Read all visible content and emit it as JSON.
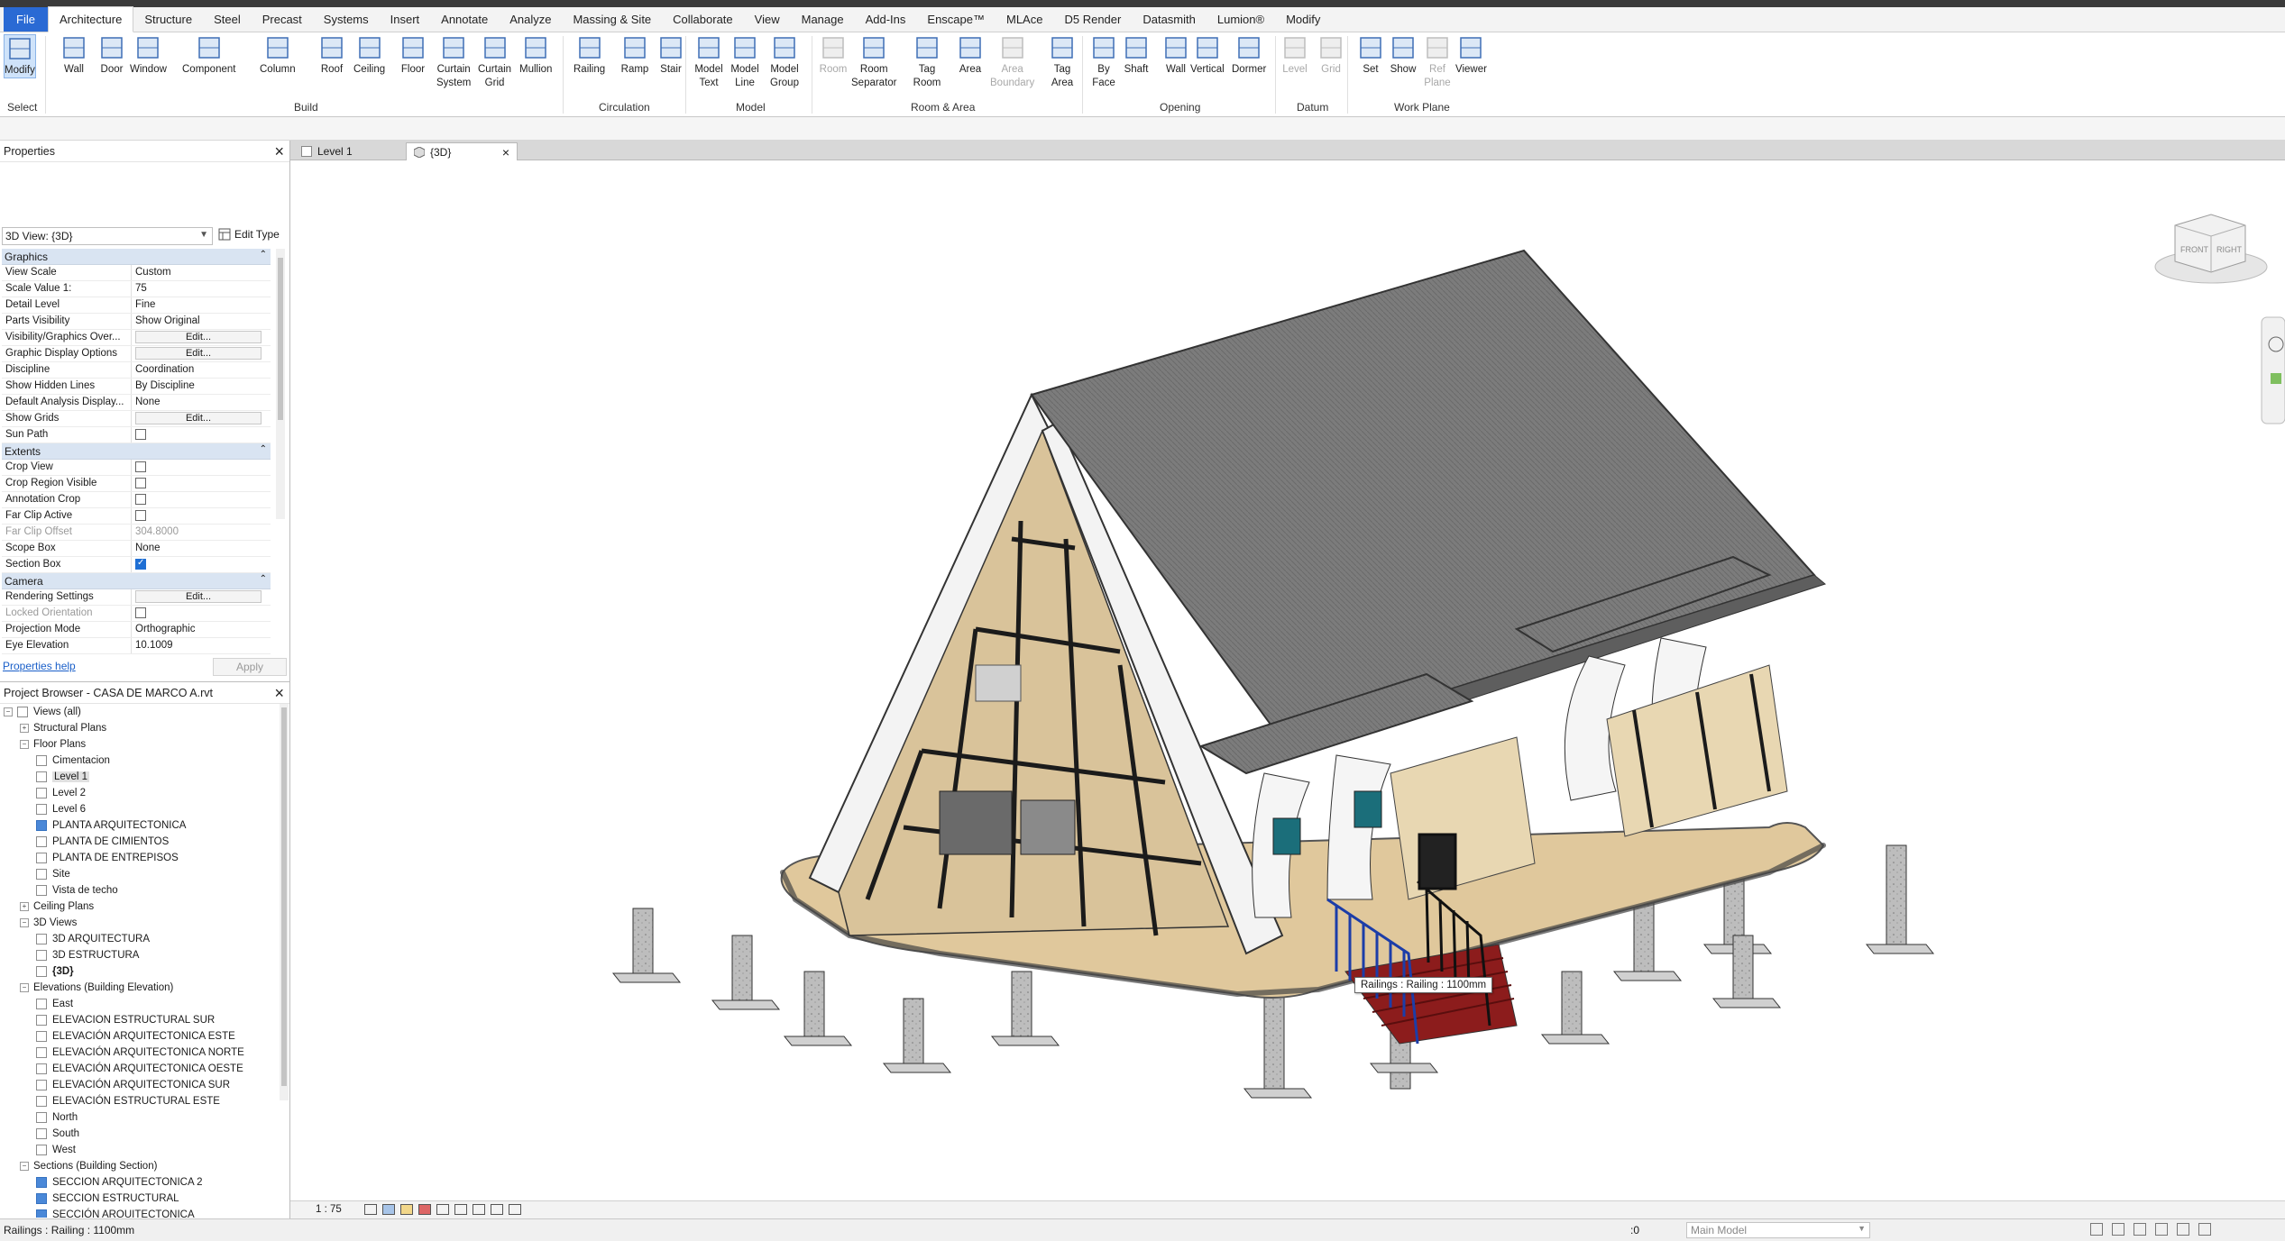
{
  "ribbon_tabs": [
    "File",
    "Architecture",
    "Structure",
    "Steel",
    "Precast",
    "Systems",
    "Insert",
    "Annotate",
    "Analyze",
    "Massing & Site",
    "Collaborate",
    "View",
    "Manage",
    "Add-Ins",
    "Enscape™",
    "MLAce",
    "D5 Render",
    "Datasmith",
    "Lumion®",
    "Modify"
  ],
  "ribbon_tools": {
    "modify": "Modify",
    "wall": "Wall",
    "door": "Door",
    "window": "Window",
    "component": "Component",
    "column": "Column",
    "roof": "Roof",
    "ceiling": "Ceiling",
    "floor": "Floor",
    "curtain_system": [
      "Curtain",
      "System"
    ],
    "curtain_grid": [
      "Curtain",
      "Grid"
    ],
    "mullion": "Mullion",
    "railing": "Railing",
    "ramp": "Ramp",
    "stair": "Stair",
    "model_text": [
      "Model",
      "Text"
    ],
    "model_line": [
      "Model",
      "Line"
    ],
    "model_group": [
      "Model",
      "Group"
    ],
    "room": "Room",
    "room_separator": [
      "Room",
      "Separator"
    ],
    "tag_room": [
      "Tag",
      "Room"
    ],
    "area": "Area",
    "area_boundary": [
      "Area",
      "Boundary"
    ],
    "tag_area": [
      "Tag",
      "Area"
    ],
    "by_face": [
      "By",
      "Face"
    ],
    "shaft": "Shaft",
    "wall_opening": "Wall",
    "vertical": "Vertical",
    "dormer": "Dormer",
    "level": "Level",
    "grid": "Grid",
    "set": "Set",
    "show": "Show",
    "ref_plane": [
      "Ref",
      "Plane"
    ],
    "viewer": "Viewer"
  },
  "ribbon_panels": {
    "select": "Select",
    "build": "Build",
    "circulation": "Circulation",
    "model": "Model",
    "room_area": "Room & Area",
    "opening": "Opening",
    "datum": "Datum",
    "work_plane": "Work Plane"
  },
  "properties": {
    "title": "Properties",
    "type_selector": "3D View: {3D}",
    "edit_type": "Edit Type",
    "groups": {
      "graphics": "Graphics",
      "extents": "Extents",
      "camera": "Camera"
    },
    "graphics_rows": [
      {
        "k": "View Scale",
        "v": "Custom"
      },
      {
        "k": "Scale Value    1:",
        "v": "75"
      },
      {
        "k": "Detail Level",
        "v": "Fine"
      },
      {
        "k": "Parts Visibility",
        "v": "Show Original"
      },
      {
        "k": "Visibility/Graphics Over...",
        "v": "Edit..."
      },
      {
        "k": "Graphic Display Options",
        "v": "Edit..."
      },
      {
        "k": "Discipline",
        "v": "Coordination"
      },
      {
        "k": "Show Hidden Lines",
        "v": "By Discipline"
      },
      {
        "k": "Default Analysis Display...",
        "v": "None"
      },
      {
        "k": "Show Grids",
        "v": "Edit..."
      },
      {
        "k": "Sun Path",
        "v": ""
      }
    ],
    "extents_rows": [
      {
        "k": "Crop View",
        "v": ""
      },
      {
        "k": "Crop Region Visible",
        "v": ""
      },
      {
        "k": "Annotation Crop",
        "v": ""
      },
      {
        "k": "Far Clip Active",
        "v": ""
      },
      {
        "k": "Far Clip Offset",
        "v": "304.8000"
      },
      {
        "k": "Scope Box",
        "v": "None"
      },
      {
        "k": "Section Box",
        "v": ""
      }
    ],
    "camera_rows": [
      {
        "k": "Rendering Settings",
        "v": "Edit..."
      },
      {
        "k": "Locked Orientation",
        "v": ""
      },
      {
        "k": "Projection Mode",
        "v": "Orthographic"
      },
      {
        "k": "Eye Elevation",
        "v": "10.1009"
      }
    ],
    "help": "Properties help",
    "apply": "Apply"
  },
  "browser": {
    "title": "Project Browser - CASA DE MARCO A.rvt",
    "views_all": "Views (all)",
    "structural_plans": "Structural Plans",
    "floor_plans": "Floor Plans",
    "floor_items": [
      "Cimentacion",
      "Level 1",
      "Level 2",
      "Level 6",
      "PLANTA ARQUITECTONICA",
      "PLANTA DE CIMIENTOS",
      "PLANTA DE ENTREPISOS",
      "Site",
      "Vista de techo"
    ],
    "ceiling_plans": "Ceiling Plans",
    "views_3d": "3D Views",
    "items_3d": [
      "3D ARQUITECTURA",
      "3D ESTRUCTURA",
      "{3D}"
    ],
    "elevations": "Elevations (Building Elevation)",
    "elevation_items": [
      "East",
      "ELEVACION ESTRUCTURAL SUR",
      "ELEVACIÓN ARQUITECTONICA ESTE",
      "ELEVACIÓN ARQUITECTONICA NORTE",
      "ELEVACIÓN ARQUITECTONICA OESTE",
      "ELEVACIÓN ARQUITECTONICA SUR",
      "ELEVACIÓN ESTRUCTURAL ESTE",
      "North",
      "South",
      "West"
    ],
    "sections": "Sections (Building Section)",
    "section_items": [
      "SECCION ARQUITECTONICA 2",
      "SECCION ESTRUCTURAL",
      "SECCIÓN ARQUITECTONICA"
    ]
  },
  "view_tabs": {
    "level1": "Level 1",
    "threed": "{3D}"
  },
  "view": {
    "tooltip": "Railings : Railing : 1100mm",
    "scale": "1 : 75",
    "viewcube_front": "FRONT",
    "viewcube_right": "RIGHT"
  },
  "status": {
    "left": "Railings : Railing : 1100mm",
    "model": "Main Model",
    "zero": ":0"
  },
  "colors": {
    "accent": "#2a6ad4",
    "railing_blue": "#1c3da8",
    "stair_red": "#8c1c1c",
    "roof": "#7a7a7a"
  }
}
